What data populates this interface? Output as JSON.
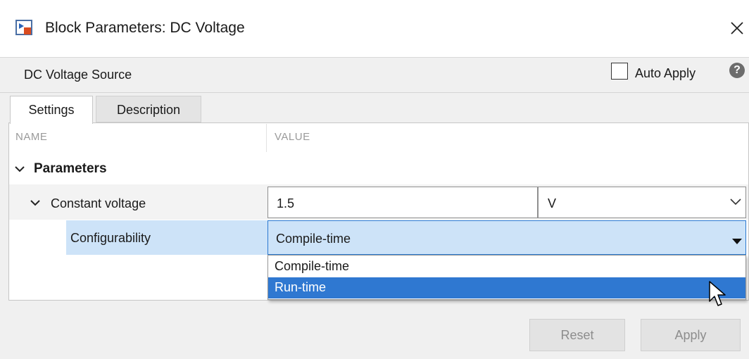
{
  "window": {
    "title": "Block Parameters: DC Voltage",
    "close_glyph": "×"
  },
  "header": {
    "block_name": "DC Voltage Source",
    "auto_apply_label": "Auto Apply",
    "auto_apply_checked": false,
    "help_glyph": "?"
  },
  "tabs": [
    {
      "label": "Settings",
      "active": true
    },
    {
      "label": "Description",
      "active": false
    }
  ],
  "table": {
    "columns": {
      "name": "NAME",
      "value": "VALUE"
    },
    "group_label": "Parameters",
    "constant_voltage": {
      "label": "Constant voltage",
      "value": "1.5",
      "unit": "V"
    },
    "configurability": {
      "label": "Configurability",
      "selected": "Compile-time",
      "options": [
        "Compile-time",
        "Run-time"
      ],
      "highlighted_option": "Run-time"
    }
  },
  "footer": {
    "reset_label": "Reset",
    "apply_label": "Apply"
  },
  "colors": {
    "selection": "#2f78d1",
    "row_highlight": "#cde3f8",
    "focus_border": "#2b79d0"
  },
  "icons": [
    "simulink-block-icon",
    "close-icon",
    "help-icon",
    "chevron-down-icon",
    "dropdown-arrow-icon",
    "mouse-cursor-icon"
  ]
}
